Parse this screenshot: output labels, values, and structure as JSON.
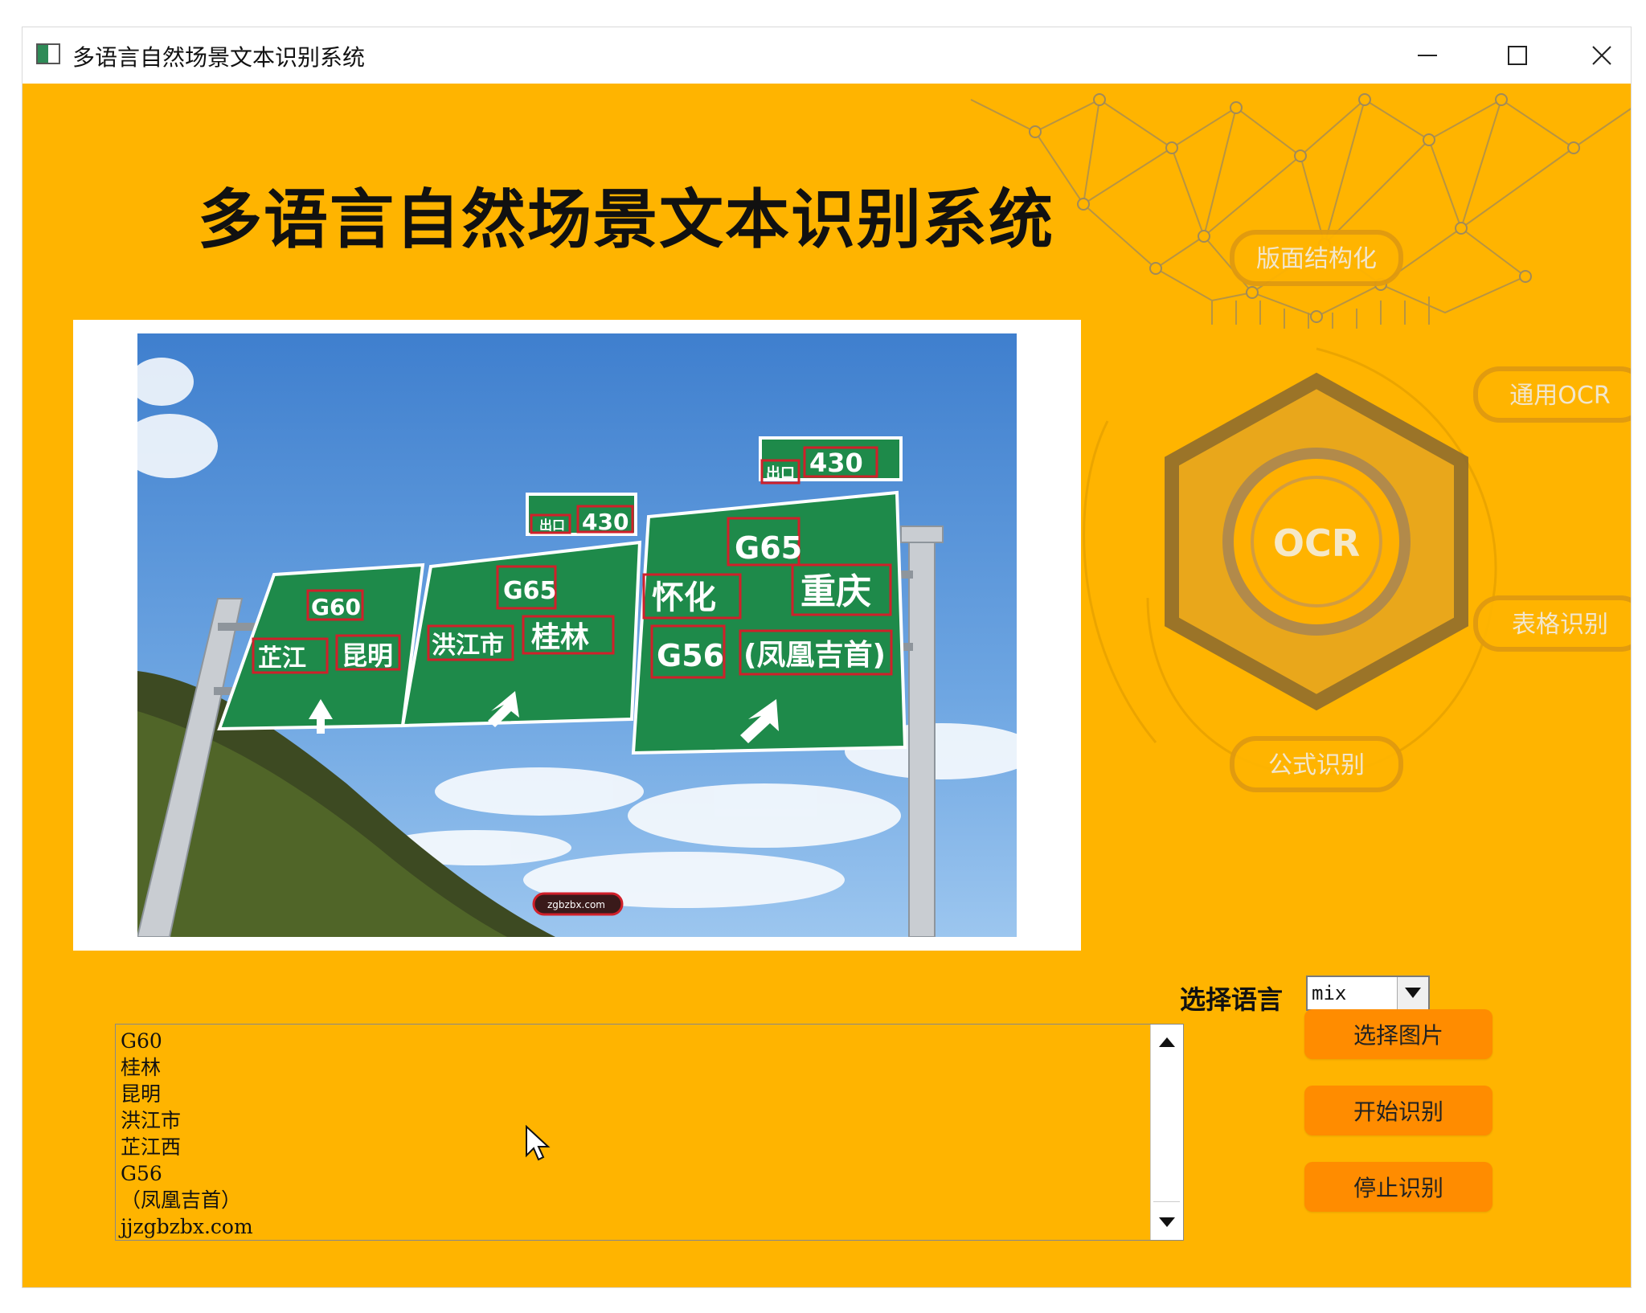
{
  "window": {
    "title": "多语言自然场景文本识别系统"
  },
  "header": {
    "title": "多语言自然场景文本识别系统"
  },
  "feature_ring": {
    "center": "OCR",
    "items": [
      "版面结构化",
      "通用OCR",
      "表格识别",
      "公式识别",
      "识别",
      "识别"
    ]
  },
  "sign_texts": [
    "出口",
    "430",
    "G60",
    "芷江",
    "昆明",
    "G65",
    "洪江市",
    "桂林",
    "怀化",
    "重庆",
    "G56",
    "(凤凰吉首)",
    "zgbzbx.com"
  ],
  "controls": {
    "language_label": "选择语言",
    "language_value": "mix",
    "select_image": "选择图片",
    "start": "开始识别",
    "stop": "停止识别"
  },
  "results": [
    "G60",
    "桂林",
    "昆明",
    "洪江市",
    "芷江西",
    "G56",
    "（凤凰吉首）",
    "jjzgbzbx.com"
  ],
  "colors": {
    "background": "#ffb400",
    "button": "#ff8c00",
    "sign_green": "#1e8a4a",
    "box_red": "#d0202a"
  }
}
